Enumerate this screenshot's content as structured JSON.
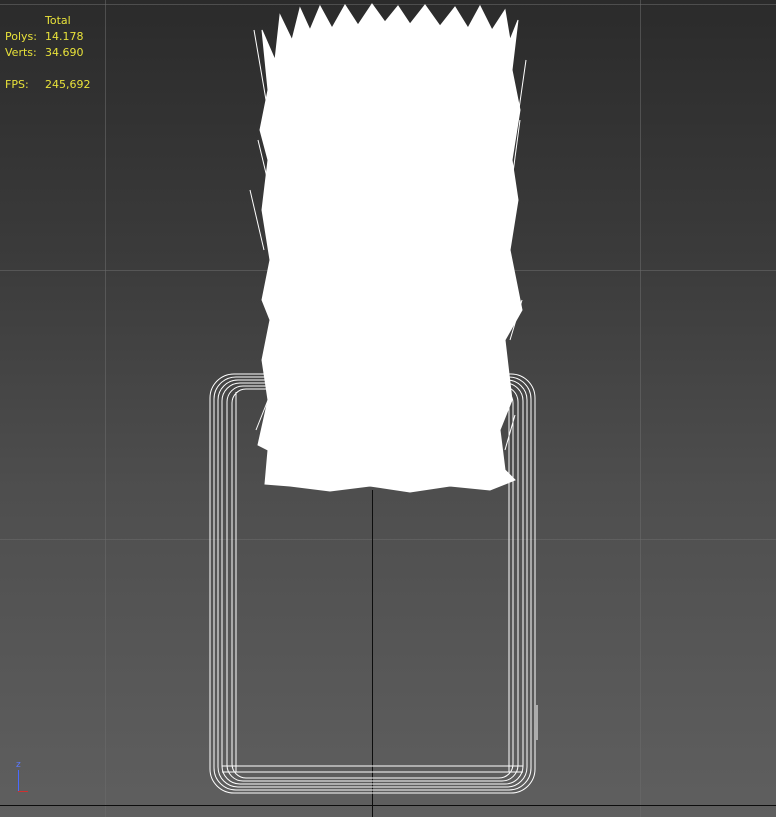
{
  "stats": {
    "header": "Total",
    "rows": [
      {
        "label": "Polys:",
        "value": "14.178"
      },
      {
        "label": "Verts:",
        "value": "34.690"
      }
    ],
    "fps_label": "FPS:",
    "fps_value": "245,692"
  },
  "gizmo": {
    "z_label": "z"
  },
  "colors": {
    "stats_text": "#e8e23a",
    "wireframe": "#ffffff",
    "grid": "#6c6c6c",
    "background_top": "#2b2b2b",
    "background_bottom": "#5f5f5f"
  }
}
